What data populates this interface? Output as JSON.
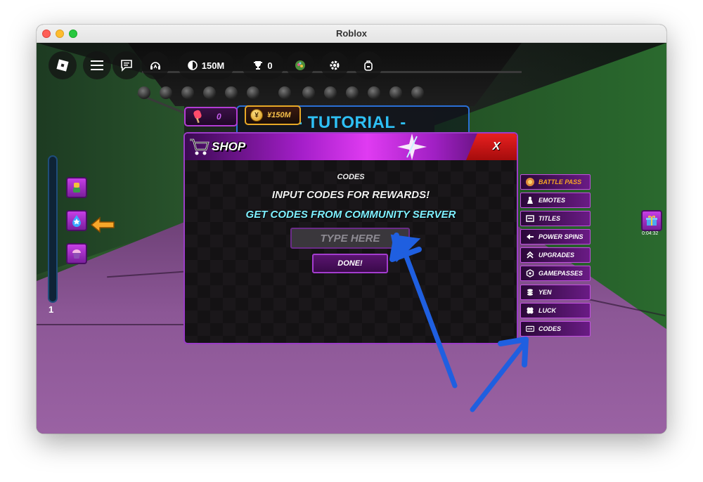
{
  "window": {
    "title": "Roblox"
  },
  "topbar": {
    "currency_value": "150M",
    "trophy_value": "0"
  },
  "stats": {
    "popsicle_value": "0",
    "yen_value": "¥150M",
    "yen_symbol": "¥"
  },
  "tutorial": {
    "title": "- TUTORIAL -"
  },
  "left_panel": {
    "level_number": "1"
  },
  "gift": {
    "timer": "0:04:32"
  },
  "shop": {
    "title": "SHOP",
    "close_label": "X",
    "section_label": "CODES",
    "headline": "INPUT CODES FOR REWARDS!",
    "subheadline": "GET CODES FROM COMMUNITY SERVER",
    "input_placeholder": "TYPE HERE",
    "done_label": "DONE!"
  },
  "side_menu": {
    "items": [
      {
        "label": "BATTLE PASS",
        "icon": "battle-pass-icon"
      },
      {
        "label": "EMOTES",
        "icon": "emote-icon"
      },
      {
        "label": "TITLES",
        "icon": "titles-icon"
      },
      {
        "label": "POWER SPINS",
        "icon": "power-spins-icon"
      },
      {
        "label": "UPGRADES",
        "icon": "upgrades-icon"
      },
      {
        "label": "GAMEPASSES",
        "icon": "gamepass-icon"
      },
      {
        "label": "YEN",
        "icon": "yen-icon"
      },
      {
        "label": "LUCK",
        "icon": "luck-icon"
      },
      {
        "label": "CODES",
        "icon": "codes-icon"
      }
    ]
  },
  "colors": {
    "accent_purple": "#c14ee0",
    "close_red": "#e82020",
    "tutorial_blue": "#2ec0f5",
    "subheadline_cyan": "#7ef0ff",
    "annotation_arrow_blue": "#1f5fe0"
  }
}
